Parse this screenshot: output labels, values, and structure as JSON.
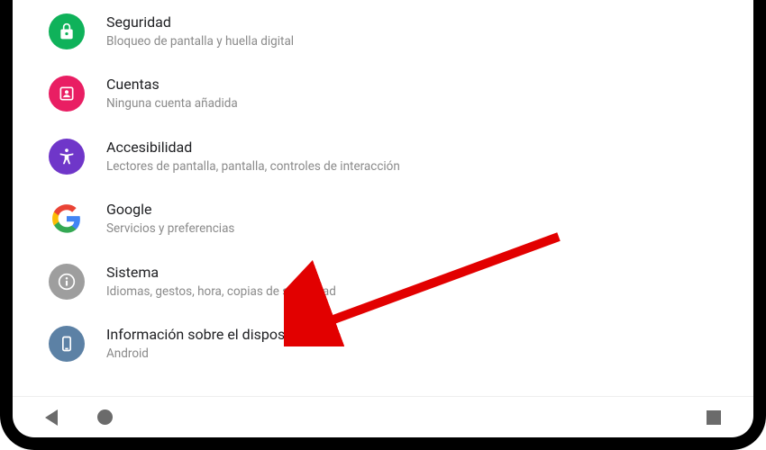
{
  "settings": {
    "items": [
      {
        "id": "security",
        "title": "Seguridad",
        "subtitle": "Bloqueo de pantalla y huella digital"
      },
      {
        "id": "accounts",
        "title": "Cuentas",
        "subtitle": "Ninguna cuenta añadida"
      },
      {
        "id": "accessibility",
        "title": "Accesibilidad",
        "subtitle": "Lectores de pantalla, pantalla, controles de interacción"
      },
      {
        "id": "google",
        "title": "Google",
        "subtitle": "Servicios y preferencias"
      },
      {
        "id": "system",
        "title": "Sistema",
        "subtitle": "Idiomas, gestos, hora, copias de seguridad"
      },
      {
        "id": "device-info",
        "title": "Información sobre el dispositivo",
        "subtitle": "Android"
      }
    ]
  },
  "annotation": {
    "arrow_color": "#e20000",
    "target_item": "device-info"
  }
}
